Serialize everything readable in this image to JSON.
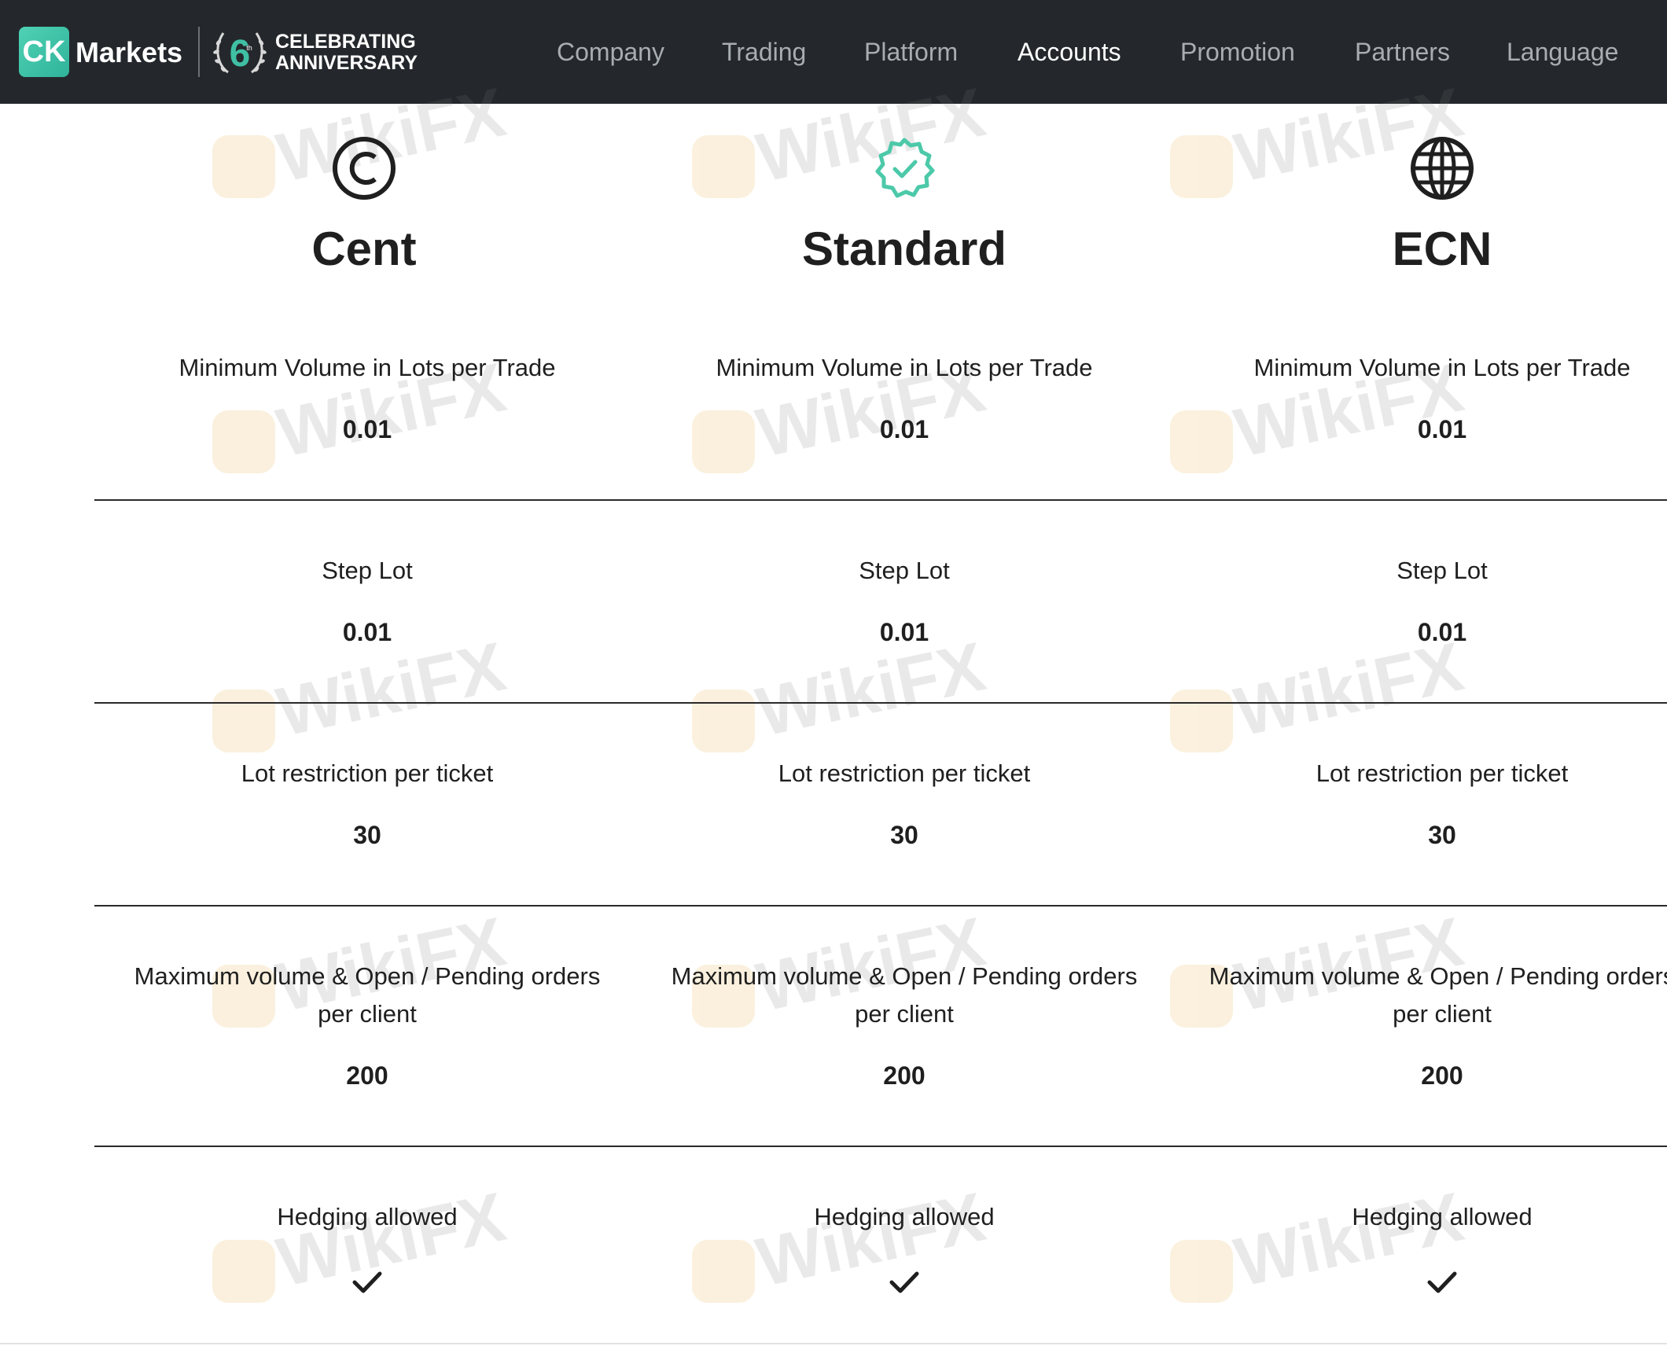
{
  "header": {
    "logo_badge": "CK",
    "logo_word": "Markets",
    "anniversary_number": "6",
    "anniversary_suffix": "th",
    "anniversary_line1": "CELEBRATING",
    "anniversary_line2": "ANNIVERSARY",
    "nav": [
      {
        "label": "Company",
        "active": false
      },
      {
        "label": "Trading",
        "active": false
      },
      {
        "label": "Platform",
        "active": false
      },
      {
        "label": "Accounts",
        "active": true
      },
      {
        "label": "Promotion",
        "active": false
      },
      {
        "label": "Partners",
        "active": false
      },
      {
        "label": "Language",
        "active": false
      }
    ]
  },
  "accounts": [
    {
      "title": "Cent",
      "icon": "cent-circle-icon",
      "rows": {
        "min_volume": {
          "label": "Minimum Volume in Lots per Trade",
          "value": "0.01"
        },
        "step_lot": {
          "label": "Step Lot",
          "value": "0.01"
        },
        "lot_restriction": {
          "label": "Lot restriction per ticket",
          "value": "30"
        },
        "max_volume": {
          "label_line1": "Maximum volume & Open / Pending orders",
          "label_line2": "per client",
          "value": "200"
        },
        "hedging": {
          "label": "Hedging allowed",
          "value_icon": "checkmark-icon"
        }
      }
    },
    {
      "title": "Standard",
      "icon": "verified-badge-icon",
      "rows": {
        "min_volume": {
          "label": "Minimum Volume in Lots per Trade",
          "value": "0.01"
        },
        "step_lot": {
          "label": "Step Lot",
          "value": "0.01"
        },
        "lot_restriction": {
          "label": "Lot restriction per ticket",
          "value": "30"
        },
        "max_volume": {
          "label_line1": "Maximum volume & Open / Pending orders",
          "label_line2": "per client",
          "value": "200"
        },
        "hedging": {
          "label": "Hedging allowed",
          "value_icon": "checkmark-icon"
        }
      }
    },
    {
      "title": "ECN",
      "icon": "globe-icon",
      "rows": {
        "min_volume": {
          "label": "Minimum Volume in Lots per Trade",
          "value": "0.01"
        },
        "step_lot": {
          "label": "Step Lot",
          "value": "0.01"
        },
        "lot_restriction": {
          "label": "Lot restriction per ticket",
          "value": "30"
        },
        "max_volume": {
          "label_line1": "Maximum volume & Open / Pending orders",
          "label_line2": "per client",
          "value": "200"
        },
        "hedging": {
          "label": "Hedging allowed",
          "value_icon": "checkmark-icon"
        }
      }
    }
  ],
  "watermark": {
    "text": "WikiFX"
  },
  "colors": {
    "header_bg": "#24282c",
    "nav_inactive": "#a8adb2",
    "nav_active": "#ffffff",
    "brand_accent": "#3fbfa4",
    "text": "#1f1f1f"
  }
}
